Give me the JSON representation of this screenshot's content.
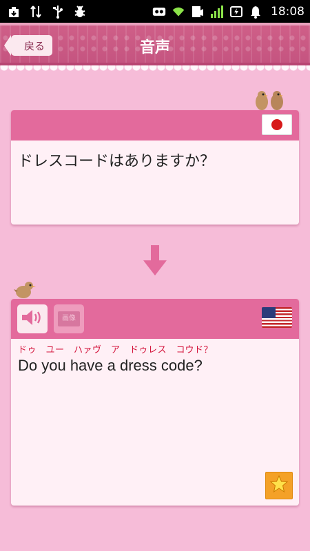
{
  "status_bar": {
    "time": "18:08",
    "left_icons": [
      "download-icon",
      "usb-data-icon",
      "usb-icon",
      "bug-icon"
    ],
    "right_icons": [
      "voicemail-icon",
      "wifi-icon",
      "call-icon",
      "signal-icon",
      "battery-icon",
      "notification-bell-icon"
    ]
  },
  "header": {
    "back_label": "戻る",
    "title": "音声"
  },
  "source": {
    "language_flag": "japan-flag",
    "text": "ドレスコードはありますか？"
  },
  "target": {
    "language_flag": "usa-flag",
    "image_button_label": "画像",
    "reading": "ドゥ　ユー　ハァヴ　ア　ドゥレス　コウド？",
    "text": "Do you have a dress code?"
  },
  "colors": {
    "background": "#f6bcd8",
    "header": "#c55480",
    "card_header": "#e36a9c",
    "card_body": "#fff0f6",
    "reading_text": "#d4153c",
    "star_button": "#f4a127"
  }
}
